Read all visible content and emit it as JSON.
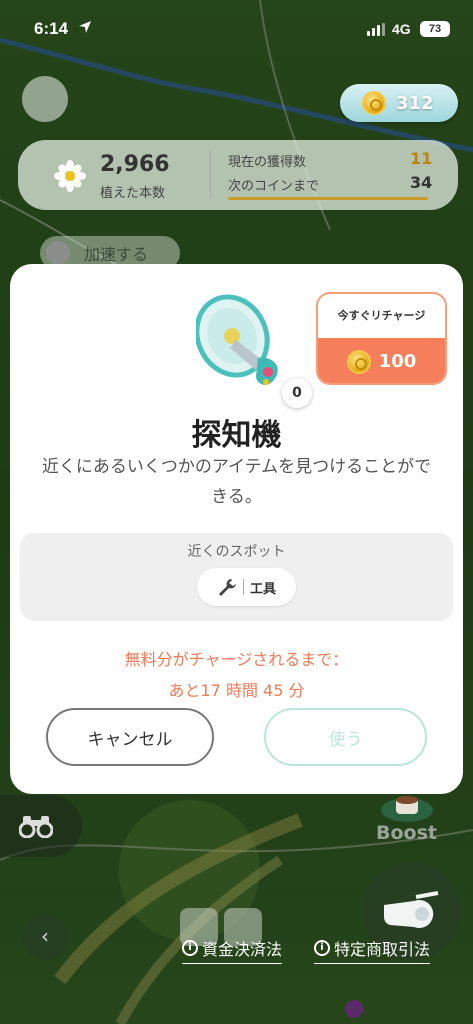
{
  "status_bar": {
    "time": "6:14",
    "network": "4G",
    "battery": "73"
  },
  "hud": {
    "coins": "312",
    "planted_count": "2,966",
    "planted_label": "植えた本数",
    "current_label": "現在の獲得数",
    "current_value": "11",
    "next_coin_label": "次のコインまで",
    "next_coin_value": "34",
    "speed_up_label": "加速する",
    "boost_label": "Boost"
  },
  "modal": {
    "recharge_now_label": "今すぐリチャージ",
    "recharge_cost": "100",
    "item_count": "0",
    "item_name": "探知機",
    "item_description": "近くにあるいくつかのアイテムを見つけることができる。",
    "nearby_spots_label": "近くのスポット",
    "spot_chip_label": "工具",
    "free_charge_line1": "無料分がチャージされるまで：",
    "free_charge_line2": "あと17 時間 45 分",
    "cancel_label": "キャンセル",
    "use_label": "使う"
  },
  "footer": {
    "legal_payment": "資金決済法",
    "legal_commerce": "特定商取引法"
  },
  "colors": {
    "accent_orange": "#f57f5b",
    "use_disabled": "#b9e6db",
    "coin_gold": "#e3a813"
  },
  "icons": [
    "location-arrow-icon",
    "coin-icon",
    "daisy-icon",
    "megaphone-detector-icon",
    "wrench-icon",
    "binoculars-icon",
    "whistle-icon",
    "chevron-left-icon",
    "info-icon"
  ]
}
